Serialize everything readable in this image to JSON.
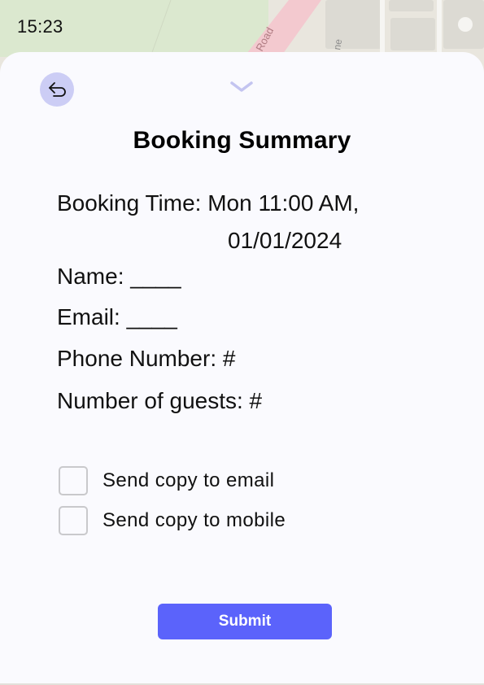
{
  "status_bar": {
    "time": "15:23"
  },
  "map": {
    "road_label": "Road",
    "road_label_2": "ne"
  },
  "header": {
    "back_icon": "return-arrow-icon",
    "collapse_icon": "chevron-down-icon"
  },
  "summary": {
    "title": "Booking Summary",
    "booking_time_label": "Booking Time: Mon 11:00 AM,",
    "booking_date": "01/01/2024",
    "name": "Name: ____",
    "email": "Email:  ____",
    "phone": "Phone Number: #",
    "guests": "Number of guests: #"
  },
  "options": {
    "email_copy_label": "Send copy to email",
    "mobile_copy_label": "Send copy to mobile"
  },
  "actions": {
    "submit_label": "Submit"
  },
  "colors": {
    "accent": "#5b63fb",
    "back_button_bg": "#cccdf5",
    "sheet_bg": "#fafafe"
  }
}
